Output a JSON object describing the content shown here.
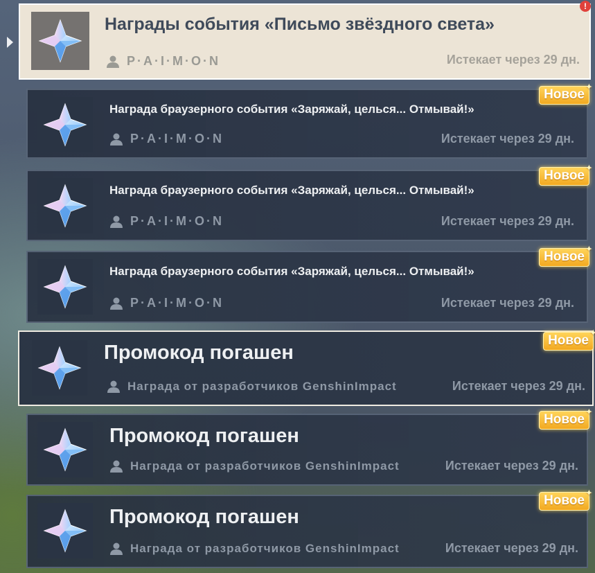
{
  "mails": [
    {
      "title": "Награды события «Письмо звёздного света»",
      "sender": "P·A·I·M·O·N",
      "expires": "Истекает через 29 дн.",
      "badge": "!",
      "icon": "primogem-icon"
    },
    {
      "title": "Награда браузерного события «Заряжай, целься... Отмывай!»",
      "sender": "P·A·I·M·O·N",
      "expires": "Истекает через 29 дн.",
      "badge": "Новое",
      "icon": "primogem-icon"
    },
    {
      "title": "Награда браузерного события «Заряжай, целься... Отмывай!»",
      "sender": "P·A·I·M·O·N",
      "expires": "Истекает через 29 дн.",
      "badge": "Новое",
      "icon": "primogem-icon"
    },
    {
      "title": "Награда браузерного события «Заряжай, целься... Отмывай!»",
      "sender": "P·A·I·M·O·N",
      "expires": "Истекает через 29 дн.",
      "badge": "Новое",
      "icon": "primogem-icon"
    },
    {
      "title": "Промокод погашен",
      "sender": "Награда от разработчиков GenshinImpact",
      "expires": "Истекает через 29 дн.",
      "badge": "Новое",
      "icon": "primogem-icon"
    },
    {
      "title": "Промокод погашен",
      "sender": "Награда от разработчиков GenshinImpact",
      "expires": "Истекает через 29 дн.",
      "badge": "Новое",
      "icon": "primogem-icon"
    },
    {
      "title": "Промокод погашен",
      "sender": "Награда от разработчиков GenshinImpact",
      "expires": "Истекает через 29 дн.",
      "badge": "Новое",
      "icon": "primogem-icon"
    }
  ],
  "colors": {
    "badge": "#f2a921",
    "unread": "#e0413b",
    "selected_bg": "#ece4d6"
  }
}
